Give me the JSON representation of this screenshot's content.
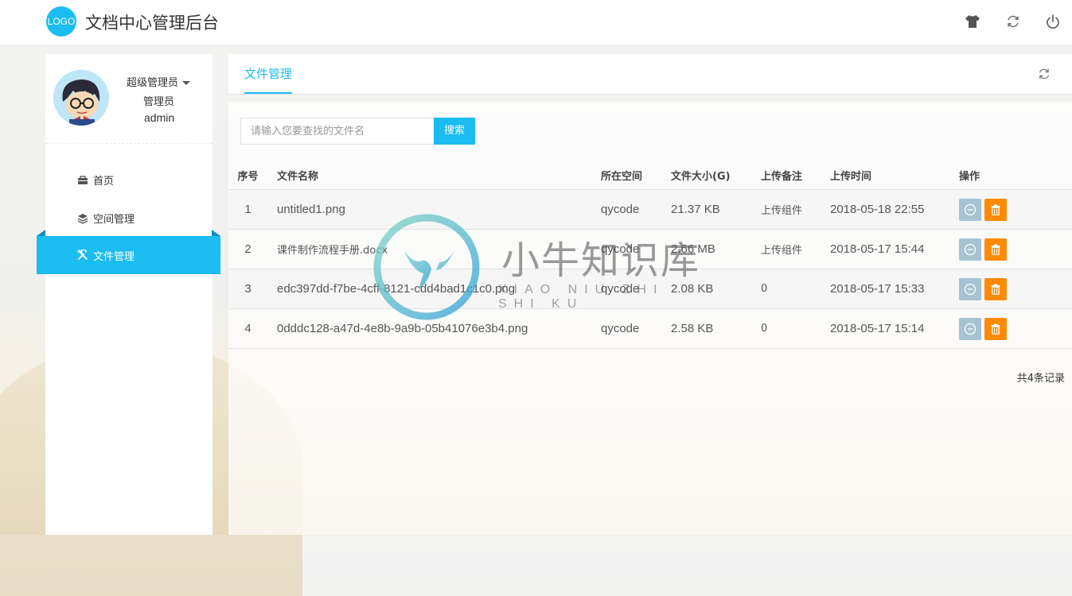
{
  "header": {
    "logo_text": "LOGO",
    "title": "文档中心管理后台",
    "icons": [
      "tshirt-icon",
      "refresh-icon",
      "power-icon"
    ]
  },
  "user": {
    "role_toggle": "超级管理员",
    "role": "管理员",
    "name": "admin"
  },
  "sidebar": {
    "items": [
      {
        "label": "首页",
        "icon": "home-icon"
      },
      {
        "label": "空间管理",
        "icon": "layers-icon"
      },
      {
        "label": "文件管理",
        "icon": "tools-icon",
        "active": true
      }
    ]
  },
  "tabs": [
    {
      "label": "文件管理"
    }
  ],
  "search": {
    "placeholder": "请输入您要查找的文件名",
    "value": "",
    "button_label": "搜索"
  },
  "table": {
    "columns": [
      "序号",
      "文件名称",
      "所在空间",
      "文件大小(G)",
      "上传备注",
      "上传时间",
      "操作"
    ],
    "rows": [
      {
        "no": "1",
        "name": "untitled1.png",
        "space": "qycode",
        "size": "21.37 KB",
        "note": "上传组件",
        "time": "2018-05-18 22:55"
      },
      {
        "no": "2",
        "name": "课件制作流程手册.docx",
        "space": "qycode",
        "size": "2.66 MB",
        "note": "上传组件",
        "time": "2018-05-17 15:44"
      },
      {
        "no": "3",
        "name": "edc397dd-f7be-4cff-8121-cdd4bad1c1c0.png",
        "space": "qycode",
        "size": "2.08 KB",
        "note": "0",
        "time": "2018-05-17 15:33"
      },
      {
        "no": "4",
        "name": "0dddc128-a47d-4e8b-9a9b-05b41076e3b4.png",
        "space": "qycode",
        "size": "2.58 KB",
        "note": "0",
        "time": "2018-05-17 15:14"
      }
    ]
  },
  "footer": {
    "total": "共4条记录"
  },
  "watermark": {
    "title": "小牛知识库",
    "subtitle": "XIAO NIU ZHI SHI KU"
  },
  "colors": {
    "accent": "#1bbcf0",
    "delete": "#ff8a00",
    "remove": "#a6c3d1"
  }
}
